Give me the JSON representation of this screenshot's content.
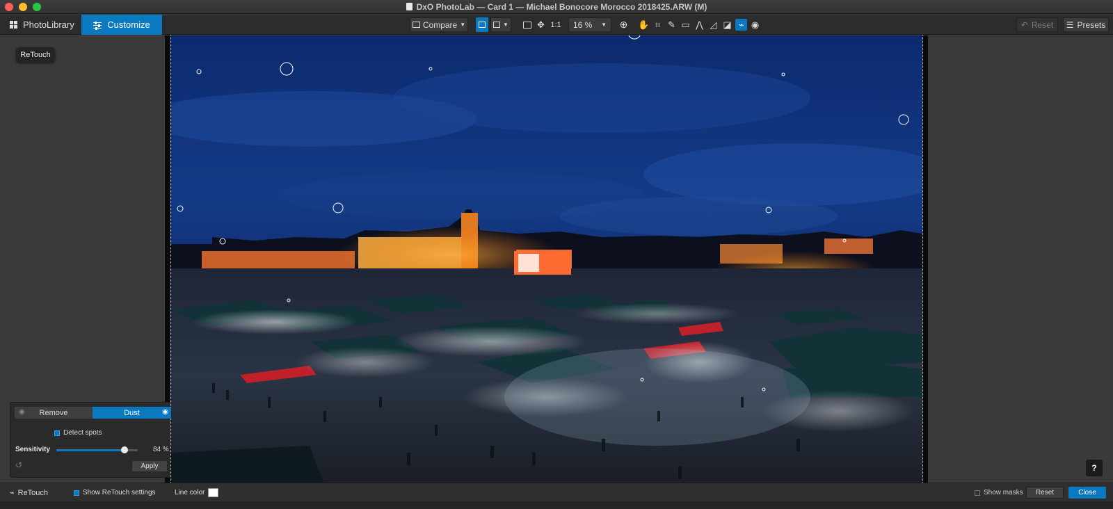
{
  "window": {
    "title": "DxO PhotoLab — Card 1 — Michael Bonocore Morocco 2018425.ARW (M)"
  },
  "tabs": [
    {
      "label": "PhotoLibrary",
      "icon": "grid-icon"
    },
    {
      "label": "Customize",
      "icon": "sliders-icon"
    }
  ],
  "toolbar": {
    "compare_label": "Compare",
    "one_to_one_label": "1:1",
    "zoom_value": "16 %",
    "reset_label": "Reset",
    "presets_label": "Presets"
  },
  "tooltip": {
    "label": "ReTouch"
  },
  "palette": {
    "remove_label": "Remove",
    "dust_label": "Dust",
    "detect_spots_label": "Detect spots",
    "sensitivity_label": "Sensitivity",
    "sensitivity_value": "84 %",
    "sensitivity_fraction": 0.84,
    "apply_label": "Apply"
  },
  "bottombar": {
    "tool_label": "ReTouch",
    "show_settings_label": "Show ReTouch settings",
    "line_color_label": "Line color",
    "show_masks_label": "Show masks",
    "reset_label": "Reset",
    "close_label": "Close"
  },
  "help": {
    "label": "?"
  },
  "colors": {
    "accent": "#0b79bf",
    "line_color": "#ffffff"
  }
}
